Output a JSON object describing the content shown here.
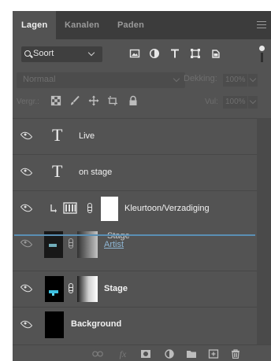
{
  "tabs": [
    {
      "label": "Lagen",
      "active": true
    },
    {
      "label": "Kanalen",
      "active": false
    },
    {
      "label": "Paden",
      "active": false
    }
  ],
  "filter": {
    "kind_label": "Soort",
    "icons": [
      "image-filter-icon",
      "adjustment-filter-icon",
      "type-filter-icon",
      "shape-filter-icon",
      "smart-object-filter-icon"
    ]
  },
  "blend": {
    "mode": "Normaal",
    "opacity_label": "Dekking:",
    "opacity_value": "100%"
  },
  "lock": {
    "label": "Vergr.:",
    "fill_label": "Vul:",
    "fill_value": "100%",
    "icons": [
      "lock-transparency-icon",
      "lock-brush-icon",
      "lock-move-icon",
      "lock-artboard-icon",
      "lock-all-icon"
    ]
  },
  "layers": [
    {
      "name": "Live",
      "kind": "text"
    },
    {
      "name": "on stage",
      "kind": "text"
    },
    {
      "name": "Kleurtoon/Verzadiging",
      "kind": "adjustment",
      "clipped": true
    },
    {
      "name": "Stage",
      "subname": "Artist",
      "kind": "dragging"
    },
    {
      "name": "Stage",
      "kind": "masked-image"
    },
    {
      "name": "Background",
      "kind": "background"
    }
  ],
  "bottom_toolbar": [
    "link-icon",
    "fx-icon",
    "mask-icon",
    "adjustment-icon",
    "group-folder-icon",
    "new-layer-icon",
    "trash-icon"
  ],
  "colors": {
    "panel_bg": "#535353",
    "tabbar_bg": "#3c3c3c",
    "drop_indicator": "#5a8fb4"
  }
}
